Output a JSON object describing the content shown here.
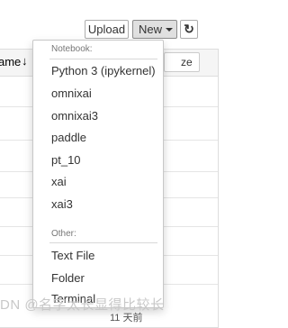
{
  "toolbar": {
    "upload_label": "Upload",
    "new_label": "New",
    "refresh_icon": "refresh-icon"
  },
  "file_list": {
    "name_header": "ame",
    "size_header": "ze",
    "row_modified_partial": "11 天前"
  },
  "new_menu": {
    "notebook_header": "Notebook:",
    "kernels": [
      "Python 3 (ipykernel)",
      "omnixai",
      "omnixai3",
      "paddle",
      "pt_10",
      "xai",
      "xai3"
    ],
    "other_header": "Other:",
    "other_items": [
      "Text File",
      "Folder",
      "Terminal"
    ]
  },
  "watermark": "DN @名字太长显得比较长"
}
